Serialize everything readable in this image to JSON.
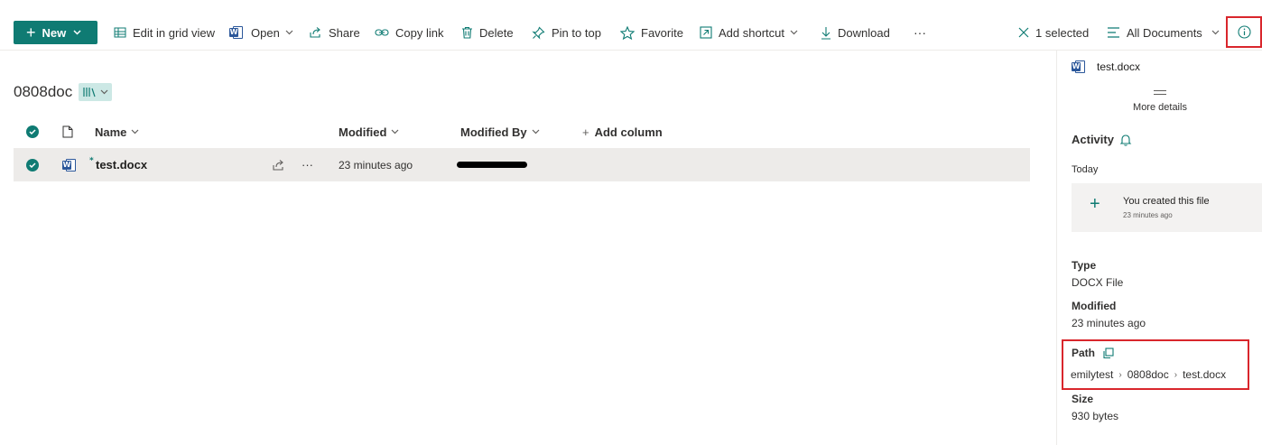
{
  "toolbar": {
    "new_label": "New",
    "edit_grid_label": "Edit in grid view",
    "open_label": "Open",
    "share_label": "Share",
    "copy_link_label": "Copy link",
    "delete_label": "Delete",
    "pin_label": "Pin to top",
    "favorite_label": "Favorite",
    "add_shortcut_label": "Add shortcut",
    "download_label": "Download",
    "more_label": "···",
    "selected_label": "1 selected",
    "view_label": "All Documents"
  },
  "library": {
    "title": "0808doc"
  },
  "columns": {
    "name": "Name",
    "modified": "Modified",
    "modified_by": "Modified By",
    "add_column": "Add column"
  },
  "rows": [
    {
      "name": "test.docx",
      "modified": "23 minutes ago",
      "more": "···"
    }
  ],
  "details": {
    "file_name": "test.docx",
    "more_details": "More details",
    "activity_heading": "Activity",
    "today_label": "Today",
    "activity_text": "You created this file",
    "activity_time": "23 minutes ago",
    "type_label": "Type",
    "type_value": "DOCX File",
    "modified_label": "Modified",
    "modified_value": "23 minutes ago",
    "path_label": "Path",
    "path": [
      "emilytest",
      "0808doc",
      "test.docx"
    ],
    "size_label": "Size",
    "size_value": "930 bytes"
  },
  "colors": {
    "accent": "#0f7b73",
    "highlight": "#d9262c",
    "selected_row": "#edebe9"
  }
}
